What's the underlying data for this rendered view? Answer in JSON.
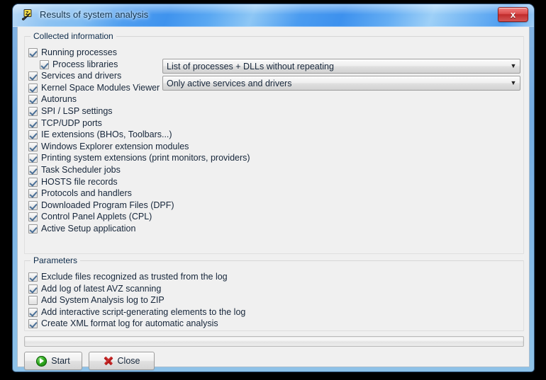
{
  "window": {
    "title": "Results of system analysis",
    "icon": "avz-app-icon",
    "close_label": "x"
  },
  "collected_information": {
    "group_title": "Collected information",
    "items": [
      {
        "label": "Running processes",
        "checked": true,
        "indent": 0
      },
      {
        "label": "Process libraries",
        "checked": true,
        "indent": 1
      },
      {
        "label": "Services and drivers",
        "checked": true,
        "indent": 0
      },
      {
        "label": "Kernel Space Modules Viewer",
        "checked": true,
        "indent": 0
      },
      {
        "label": "Autoruns",
        "checked": true,
        "indent": 0
      },
      {
        "label": "SPI / LSP settings",
        "checked": true,
        "indent": 0
      },
      {
        "label": "TCP/UDP ports",
        "checked": true,
        "indent": 0
      },
      {
        "label": "IE extensions (BHOs, Toolbars...)",
        "checked": true,
        "indent": 0
      },
      {
        "label": "Windows Explorer extension modules",
        "checked": true,
        "indent": 0
      },
      {
        "label": "Printing system extensions (print monitors, providers)",
        "checked": true,
        "indent": 0
      },
      {
        "label": "Task Scheduler jobs",
        "checked": true,
        "indent": 0
      },
      {
        "label": "HOSTS file records",
        "checked": true,
        "indent": 0
      },
      {
        "label": "Protocols and handlers",
        "checked": true,
        "indent": 0
      },
      {
        "label": "Downloaded Program Files (DPF)",
        "checked": true,
        "indent": 0
      },
      {
        "label": "Control Panel Applets (CPL)",
        "checked": true,
        "indent": 0
      },
      {
        "label": "Active Setup application",
        "checked": true,
        "indent": 0
      }
    ],
    "combos": [
      {
        "name": "processes-mode",
        "value": "List of processes + DLLs without repeating",
        "arrow": "▼"
      },
      {
        "name": "services-mode",
        "value": "Only active services and drivers",
        "arrow": "▼"
      }
    ]
  },
  "parameters": {
    "group_title": "Parameters",
    "items": [
      {
        "label": "Exclude files recognized as trusted from the log",
        "checked": true
      },
      {
        "label": "Add log of latest AVZ scanning",
        "checked": true
      },
      {
        "label": "Add System Analysis log to ZIP",
        "checked": false
      },
      {
        "label": "Add interactive script-generating elements to the log",
        "checked": true
      },
      {
        "label": "Create XML format log for automatic analysis",
        "checked": true
      }
    ]
  },
  "progress": {
    "value": 0
  },
  "buttons": {
    "start": {
      "label": "Start",
      "icon": "play-icon"
    },
    "close": {
      "label": "Close",
      "icon": "x-icon"
    }
  },
  "colors": {
    "accent": "#4f9ef0",
    "close_red": "#c02c2c",
    "start_green": "#2fa81f",
    "client_bg": "#f0f0f0",
    "text": "#16263a"
  }
}
